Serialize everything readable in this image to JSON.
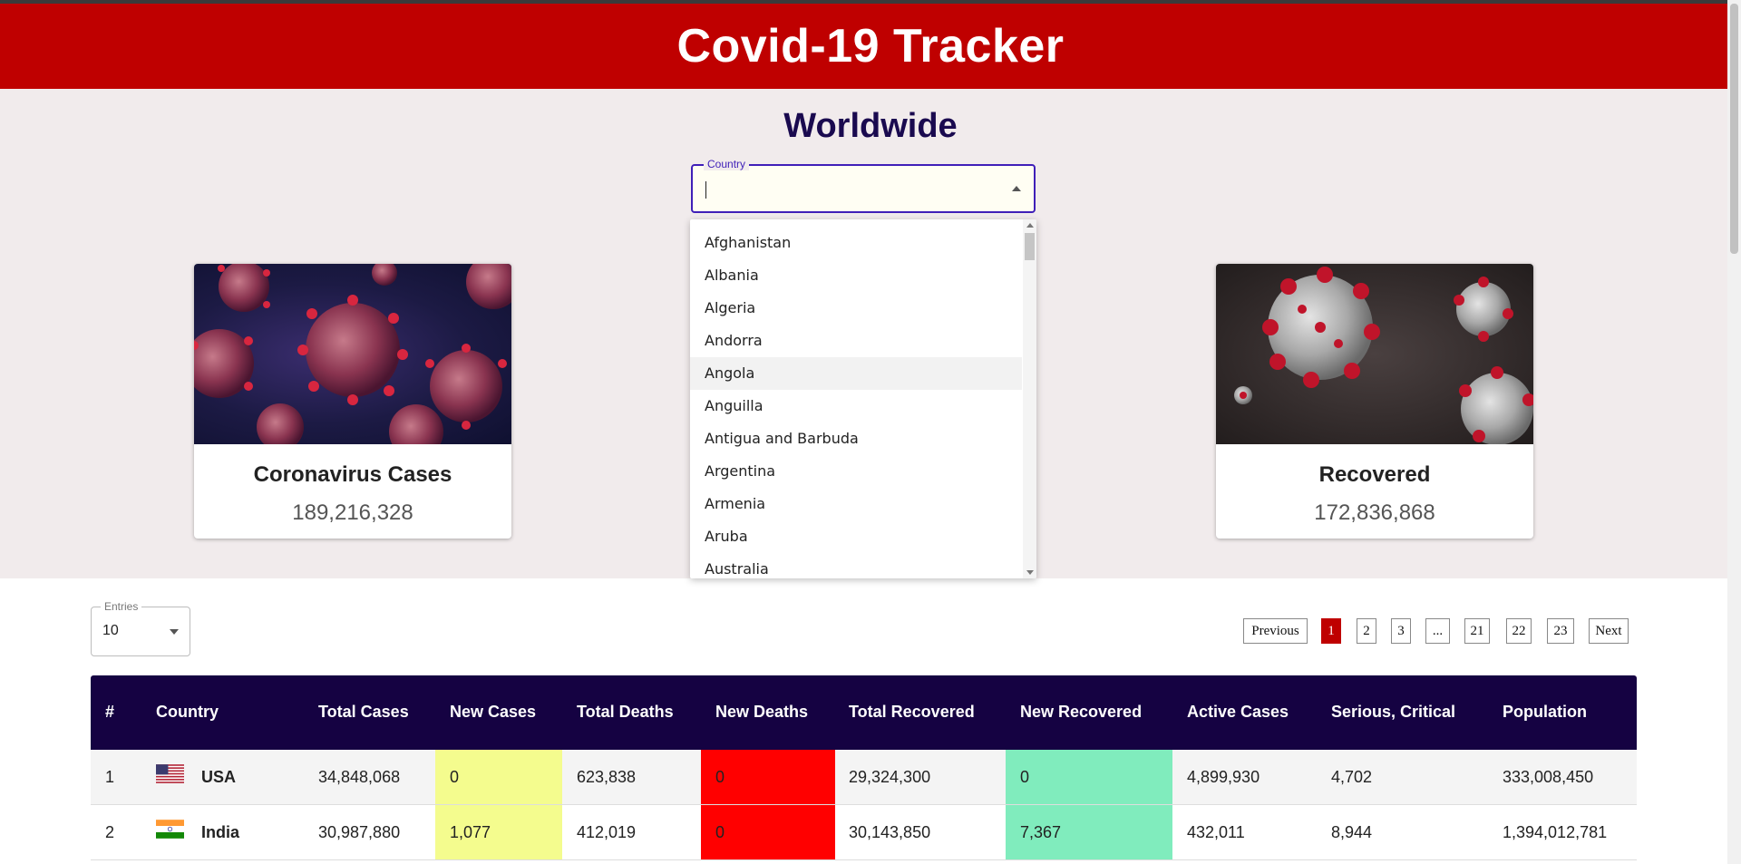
{
  "header": {
    "title": "Covid-19 Tracker"
  },
  "hero": {
    "title": "Worldwide"
  },
  "country_select": {
    "label": "Country",
    "value": "",
    "options": [
      "Afghanistan",
      "Albania",
      "Algeria",
      "Andorra",
      "Angola",
      "Anguilla",
      "Antigua and Barbuda",
      "Argentina",
      "Armenia",
      "Aruba",
      "Australia"
    ],
    "hovered": "Angola"
  },
  "cards": {
    "cases": {
      "title": "Coronavirus Cases",
      "value": "189,216,328"
    },
    "recovered": {
      "title": "Recovered",
      "value": "172,836,868"
    }
  },
  "entries": {
    "label": "Entries",
    "value": "10"
  },
  "pagination": {
    "previous": "Previous",
    "pages": [
      "1",
      "2",
      "3",
      "...",
      "21",
      "22",
      "23"
    ],
    "active": "1",
    "next": "Next"
  },
  "table": {
    "columns": [
      "#",
      "Country",
      "Total Cases",
      "New Cases",
      "Total Deaths",
      "New Deaths",
      "Total Recovered",
      "New Recovered",
      "Active Cases",
      "Serious, Critical",
      "Population"
    ],
    "rows": [
      {
        "rank": "1",
        "flag": "usa-flag",
        "country": "USA",
        "total_cases": "34,848,068",
        "new_cases": "0",
        "total_deaths": "623,838",
        "new_deaths": "0",
        "total_recovered": "29,324,300",
        "new_recovered": "0",
        "active_cases": "4,899,930",
        "serious_critical": "4,702",
        "population": "333,008,450"
      },
      {
        "rank": "2",
        "flag": "india-flag",
        "country": "India",
        "total_cases": "30,987,880",
        "new_cases": "1,077",
        "total_deaths": "412,019",
        "new_deaths": "0",
        "total_recovered": "30,143,850",
        "new_recovered": "7,367",
        "active_cases": "432,011",
        "serious_critical": "8,944",
        "population": "1,394,012,781"
      }
    ]
  },
  "colors": {
    "header": "#bf0000",
    "hero_bg": "#f1ebec",
    "table_header": "#150242",
    "new_cases": "#f4fc8e",
    "new_deaths": "#ff0000",
    "new_recovered": "#80ecbd"
  }
}
